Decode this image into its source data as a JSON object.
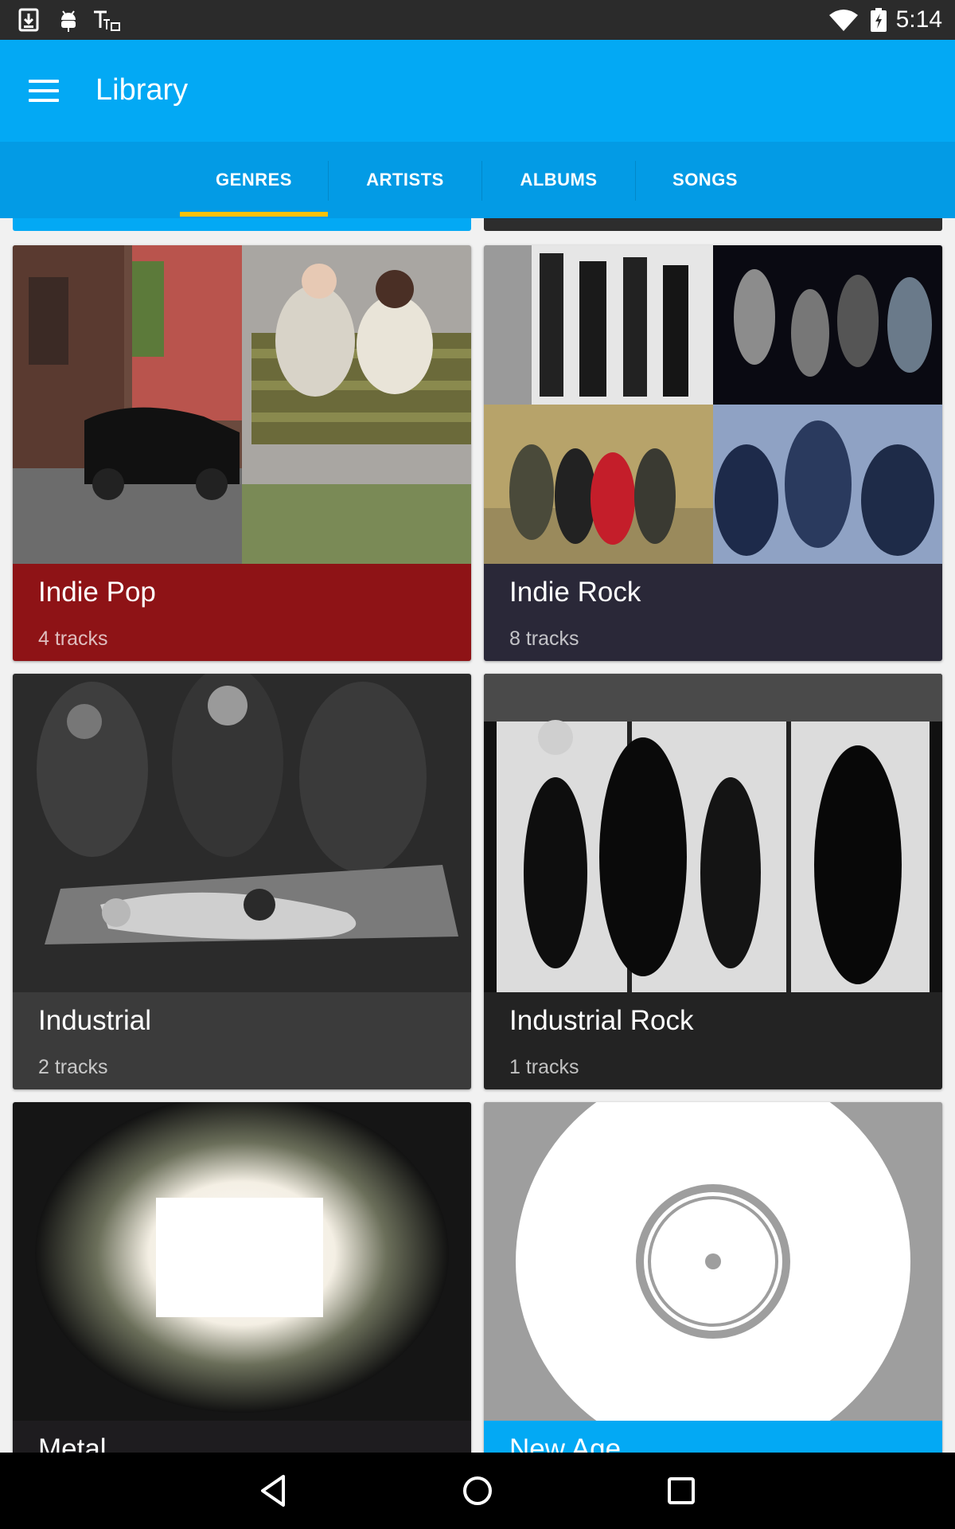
{
  "status_bar": {
    "time": "5:14"
  },
  "app_bar": {
    "title": "Library"
  },
  "tabs": [
    {
      "label": "GENRES",
      "selected": true
    },
    {
      "label": "ARTISTS",
      "selected": false
    },
    {
      "label": "ALBUMS",
      "selected": false
    },
    {
      "label": "SONGS",
      "selected": false
    }
  ],
  "colors": {
    "primary": "#03a9f4",
    "primary_dark": "#039be5",
    "accent": "#ffc107",
    "indie_pop": "#8e1316",
    "indie_rock": "#2a2838",
    "industrial": "#3b3b3b",
    "industrial_rock": "#232323",
    "metal": "#1e1c1f",
    "new_age": "#03a9f4"
  },
  "genres": [
    {
      "name": "Indie Pop",
      "tracks": "4 tracks"
    },
    {
      "name": "Indie Rock",
      "tracks": "8 tracks"
    },
    {
      "name": "Industrial",
      "tracks": "2 tracks"
    },
    {
      "name": "Industrial Rock",
      "tracks": "1 tracks"
    },
    {
      "name": "Metal",
      "tracks": ""
    },
    {
      "name": "New Age",
      "tracks": ""
    }
  ]
}
